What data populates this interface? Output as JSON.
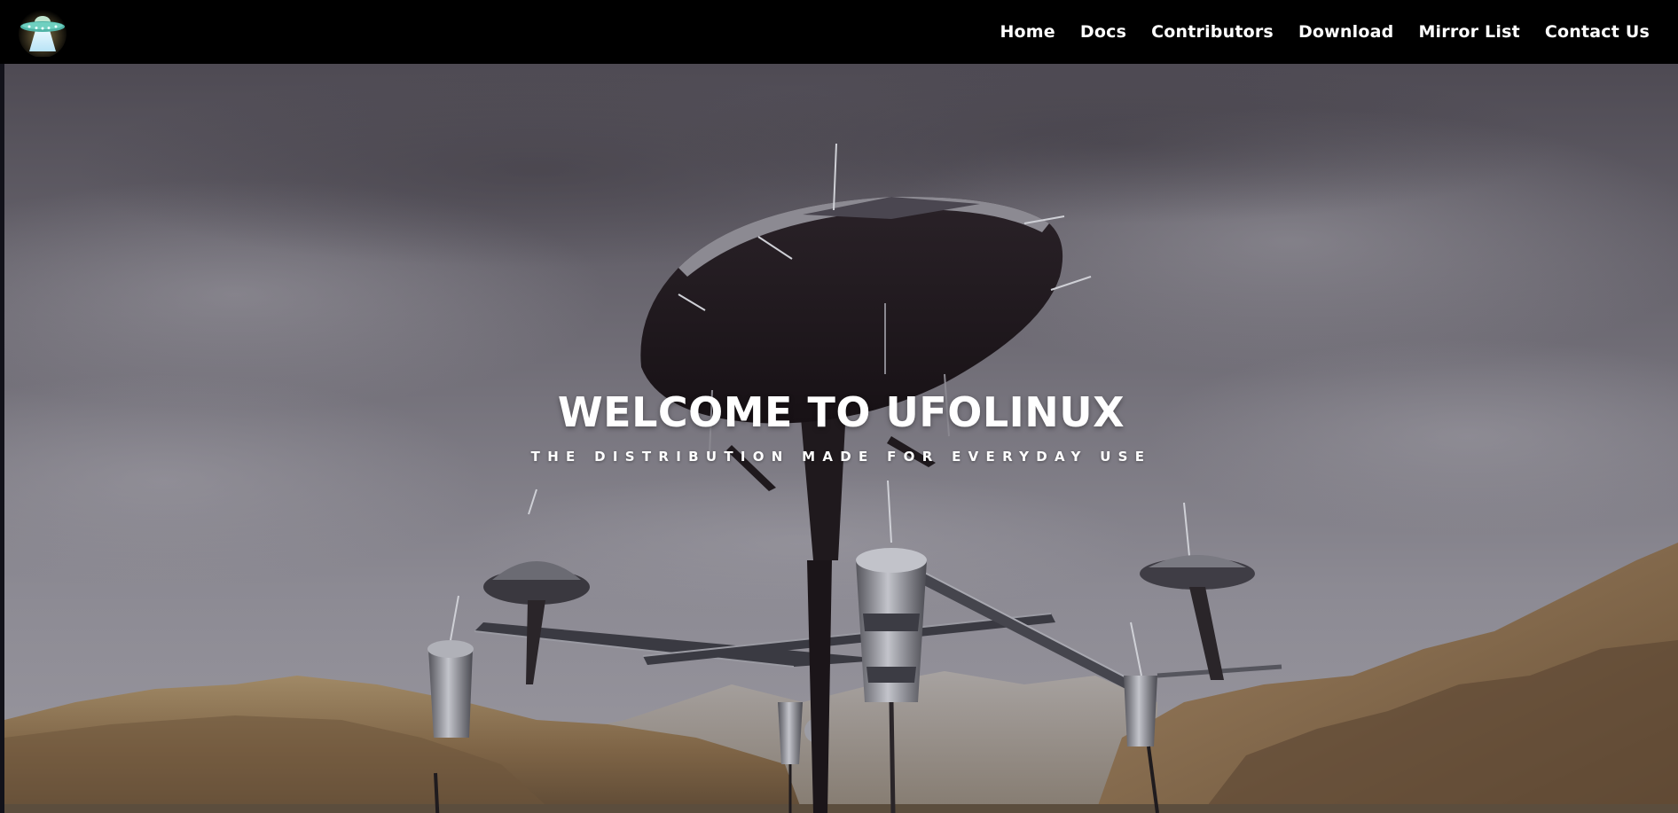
{
  "brand": {
    "logo_icon": "ufo-icon"
  },
  "nav": {
    "items": [
      {
        "label": "Home"
      },
      {
        "label": "Docs"
      },
      {
        "label": "Contributors"
      },
      {
        "label": "Download"
      },
      {
        "label": "Mirror List"
      },
      {
        "label": "Contact Us"
      }
    ]
  },
  "hero": {
    "title": "WELCOME TO UFOLINUX",
    "subtitle": "THE DISTRIBUTION MADE FOR EVERYDAY USE",
    "background": "alien-city-towers-over-desert-scene"
  },
  "colors": {
    "navbar_bg": "#000000",
    "nav_text": "#ffffff",
    "sky": "#76737c",
    "terrain": "#8a7150",
    "structure": "#1b1519"
  }
}
